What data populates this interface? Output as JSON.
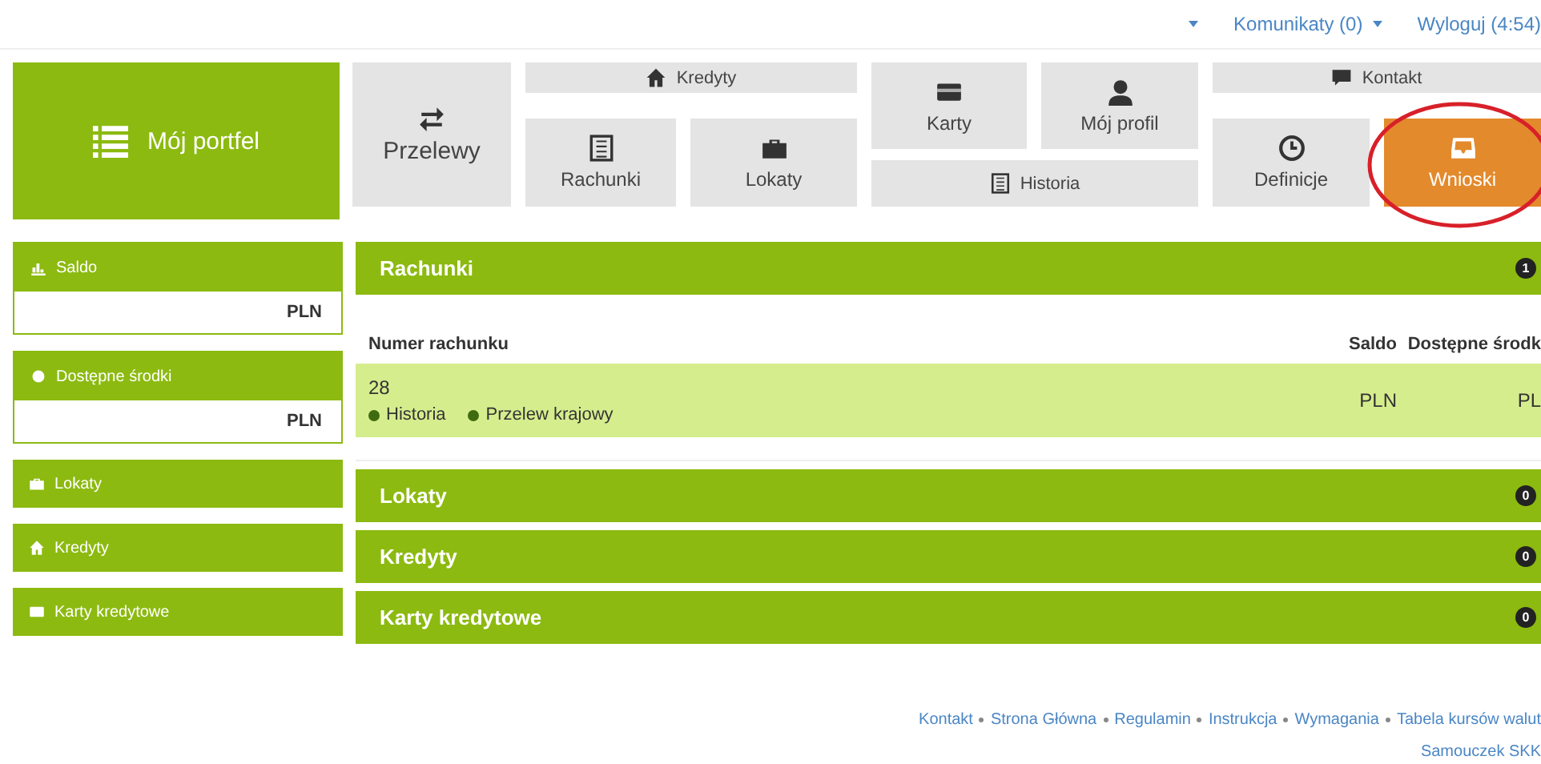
{
  "top_links": [
    {
      "kind": "caret"
    },
    {
      "label": "Komunikaty (0)",
      "kind": "dropdown"
    },
    {
      "label": "Wyloguj (4:54)",
      "kind": "link"
    }
  ],
  "portfolio_tile": {
    "label": "Mój portfel"
  },
  "nav_tiles": [
    {
      "label": "Przelewy",
      "selected": false
    },
    {
      "label": "Kredyty",
      "selected": false
    },
    {
      "label": "Rachunki",
      "selected": false
    },
    {
      "label": "Lokaty",
      "selected": false
    },
    {
      "label": "Karty",
      "selected": false
    },
    {
      "label": "Mój profil",
      "selected": false
    },
    {
      "label": "Historia",
      "selected": false
    },
    {
      "label": "Kontakt",
      "selected": false
    },
    {
      "label": "Definicje",
      "selected": false
    },
    {
      "label": "Wnioski",
      "selected": true,
      "highlighted": true
    }
  ],
  "sidebar": [
    {
      "label": "Saldo",
      "value": "PLN"
    },
    {
      "label": "Dostępne środki",
      "value": "PLN"
    },
    {
      "label": "Lokaty"
    },
    {
      "label": "Kredyty"
    },
    {
      "label": "Karty kredytowe"
    }
  ],
  "sections": [
    {
      "title": "Rachunki",
      "count": "1",
      "table": {
        "columns": [
          "Numer rachunku",
          "Saldo",
          "Dostępne środk"
        ],
        "rows": [
          {
            "number": "28",
            "actions": [
              "Historia",
              "Przelew krajowy"
            ],
            "balance": "PLN",
            "available": "PL"
          }
        ]
      }
    },
    {
      "title": "Lokaty",
      "count": "0"
    },
    {
      "title": "Kredyty",
      "count": "0"
    },
    {
      "title": "Karty kredytowe",
      "count": "0"
    }
  ],
  "footer": {
    "links": [
      "Kontakt",
      "Strona Główna",
      "Regulamin",
      "Instrukcja",
      "Wymagania",
      "Tabela kursów walut"
    ],
    "second_line": "Samouczek SKK"
  }
}
